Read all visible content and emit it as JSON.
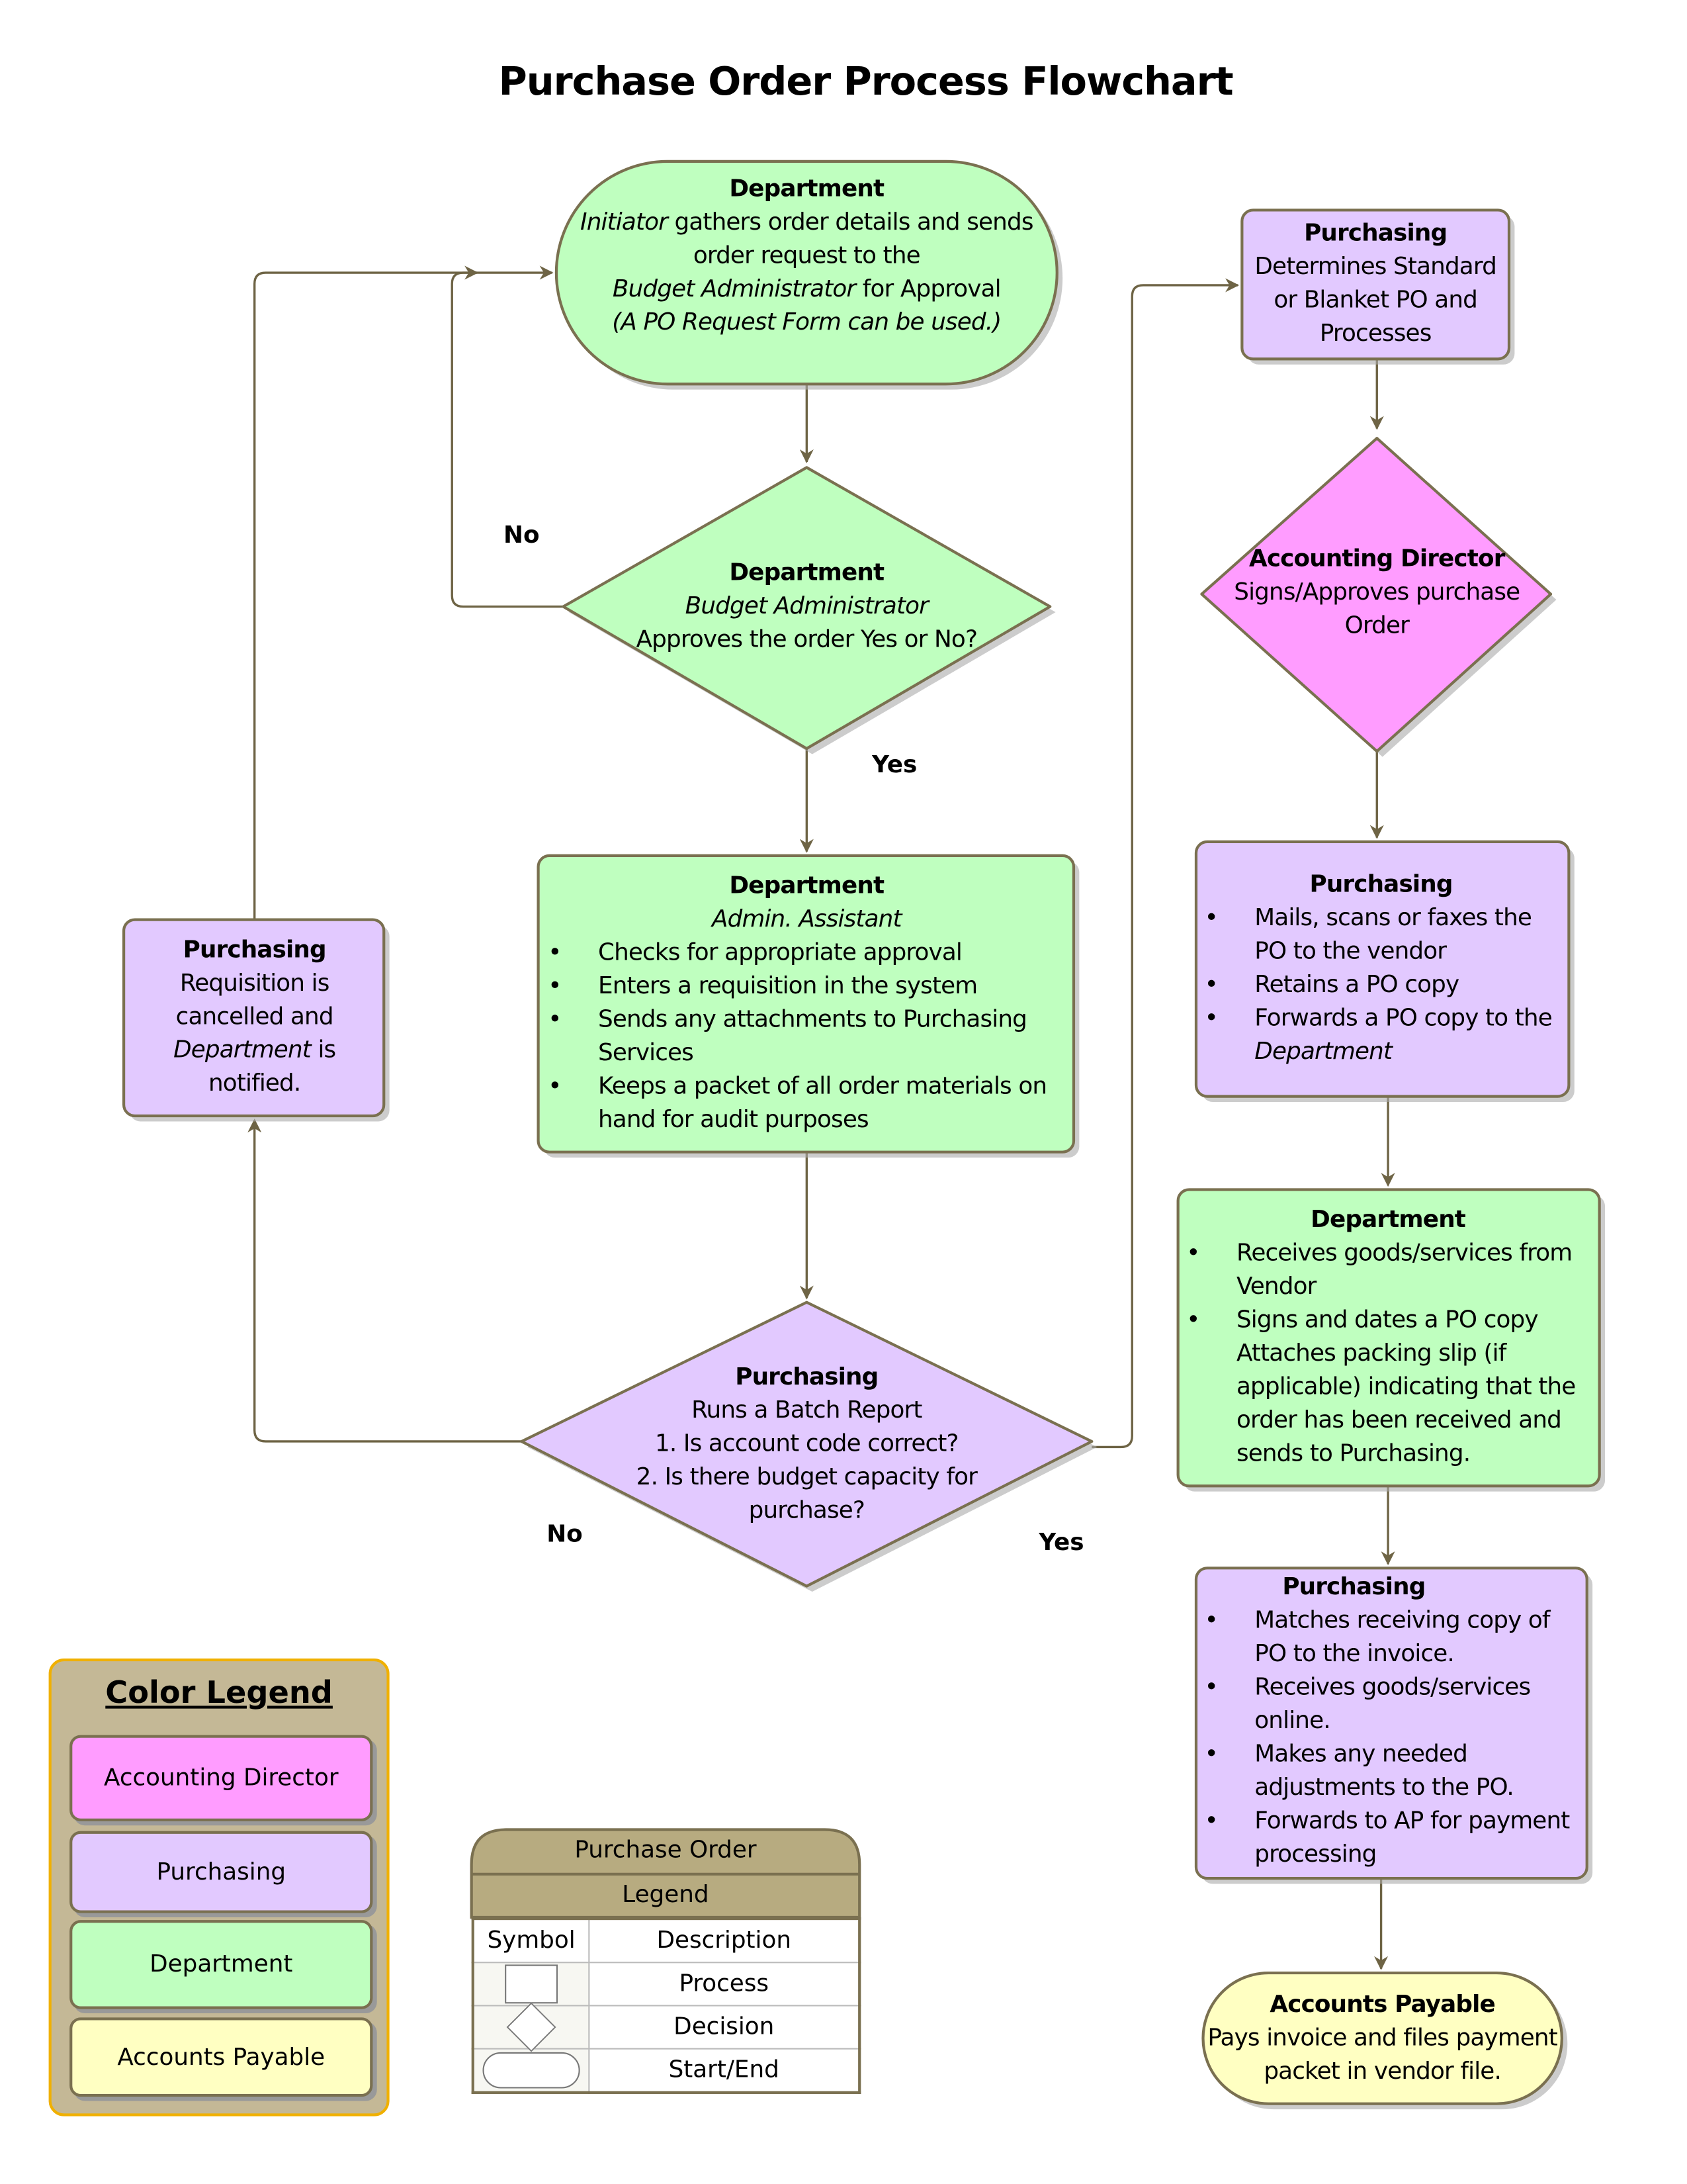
{
  "title": "Purchase Order Process Flowchart",
  "colors": {
    "accounting_director": "#ff9cff",
    "purchasing": "#e2c9ff",
    "department": "#bfffbf",
    "accounts_payable": "#ffffc2",
    "connector": "#6e6445",
    "legend_bg": "#c4b896"
  },
  "nodes": {
    "start": {
      "role": "Department",
      "line1_italic": "Initiator",
      "line1": " gathers order details and sends",
      "line2": "order request to the",
      "line3_italic": "Budget Administrator",
      "line3": " for Approval",
      "line4": "(A PO Request Form can be used.)"
    },
    "decision1": {
      "role": "Department",
      "sub": "Budget Administrator",
      "text": "Approves the order Yes or No?"
    },
    "process1": {
      "role": "Department",
      "sub": "Admin. Assistant",
      "items": [
        "Checks for appropriate approval",
        "Enters a requisition in the system",
        " Sends any attachments to Purchasing Services",
        "Keeps a packet of all order materials on hand for audit purposes"
      ]
    },
    "decision2": {
      "role": "Purchasing",
      "sub": "Runs a Batch Report",
      "items": [
        "1.  Is  account code correct?",
        "2.  Is there budget capacity for purchase?"
      ]
    },
    "cancel": {
      "role": "Purchasing",
      "line1": "Requisition is",
      "line2": "cancelled and",
      "line3_italic": "Department",
      "line3": " is",
      "line4": "notified."
    },
    "purch1": {
      "role": "Purchasing",
      "text": "Determines Standard or Blanket PO and Processes"
    },
    "director": {
      "role": "Accounting Director",
      "text": "Signs/Approves purchase Order"
    },
    "purch2": {
      "role": "Purchasing",
      "items": [
        " Mails, scans or faxes the PO to the vendor",
        "Retains a PO copy",
        "Forwards a PO copy to the"
      ],
      "last_italic": "Department"
    },
    "dept2": {
      "role": "Department",
      "items": [
        "Receives goods/services from Vendor",
        "Signs and dates a PO copy"
      ],
      "extra": "Attaches packing slip (if applicable) indicating that the order has been received and sends to Purchasing."
    },
    "purch3": {
      "role": "Purchasing",
      "items": [
        " Matches receiving copy of PO to the invoice.",
        "Receives goods/services online.",
        "Makes any needed adjustments to the PO.",
        "Forwards to AP for payment processing"
      ]
    },
    "end": {
      "role": "Accounts Payable",
      "text": "Pays invoice and files payment packet in vendor file."
    }
  },
  "labels": {
    "no1": "No",
    "yes1": "Yes",
    "no2": "No",
    "yes2": "Yes"
  },
  "color_legend": {
    "title": "Color Legend",
    "items": [
      "Accounting Director",
      "Purchasing",
      "Department",
      "Accounts Payable"
    ]
  },
  "symbol_legend": {
    "title": "Purchase Order",
    "subtitle": "Legend",
    "headers": [
      "Symbol",
      "Description"
    ],
    "rows": [
      {
        "symbol": "rectangle",
        "description": "Process"
      },
      {
        "symbol": "diamond",
        "description": "Decision"
      },
      {
        "symbol": "rounded",
        "description": "Start/End"
      }
    ]
  }
}
